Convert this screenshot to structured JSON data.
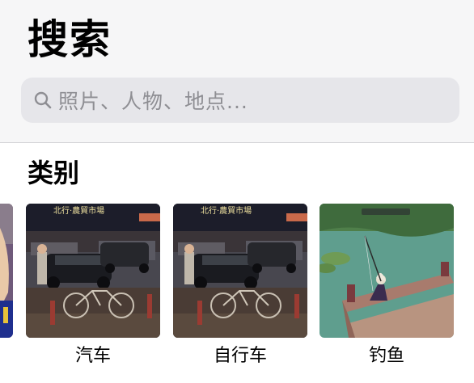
{
  "header": {
    "title": "搜索"
  },
  "search": {
    "placeholder": "照片、人物、地点..."
  },
  "categories": {
    "title": "类别",
    "items": [
      {
        "label": "汽车",
        "sign": "北行·農貿市場"
      },
      {
        "label": "自行车",
        "sign": "北行·農貿市場"
      },
      {
        "label": "钓鱼"
      }
    ]
  },
  "icons": [
    "search-icon"
  ],
  "colors": {
    "top_background": "#f6f6f7",
    "search_background": "#e6e6ea",
    "placeholder": "#8e8e93"
  }
}
